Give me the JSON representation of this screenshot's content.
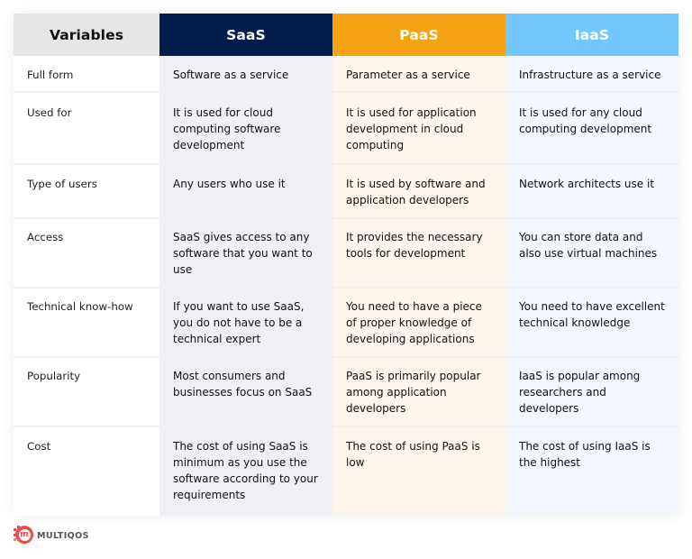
{
  "table": {
    "headers": [
      "Variables",
      "SaaS",
      "PaaS",
      "IaaS"
    ],
    "header_colors": {
      "variables": "#e6e6e6",
      "saas": "#021d49",
      "paas": "#f5a213",
      "iaas": "#72c8fd"
    },
    "rows": [
      {
        "variable": "Full form",
        "saas": "Software as a service",
        "paas": "Parameter as a service",
        "iaas": "Infrastructure as a service"
      },
      {
        "variable": "Used for",
        "saas": "It is used for cloud computing software development",
        "paas": "It is used for application development in cloud computing",
        "iaas": "It is used for any cloud computing development"
      },
      {
        "variable": "Type of users",
        "saas": "Any users who use it",
        "paas": "It is used by software and application developers",
        "iaas": "Network architects use it"
      },
      {
        "variable": "Access",
        "saas": "SaaS gives access to any software that you want to use",
        "paas": "It provides the necessary tools for development",
        "iaas": "You can store data and also use virtual machines"
      },
      {
        "variable": "Technical know-how",
        "saas": "If you want to use SaaS, you do not have to be a technical expert",
        "paas": "You need to have a piece of proper knowledge of developing applications",
        "iaas": "You need to have excellent technical knowledge"
      },
      {
        "variable": "Popularity",
        "saas": "Most consumers and businesses focus on SaaS",
        "paas": "PaaS is primarily popular among application developers",
        "iaas": "IaaS is popular among researchers and developers"
      },
      {
        "variable": "Cost",
        "saas": "The cost of using SaaS is minimum as you use the software according to your requirements",
        "paas": "The cost of using PaaS is low",
        "iaas": "The cost of using IaaS is the highest"
      }
    ]
  },
  "brand": {
    "logo_letter": "m",
    "name": "MULTIQOS",
    "color": "#ef4a4a"
  }
}
